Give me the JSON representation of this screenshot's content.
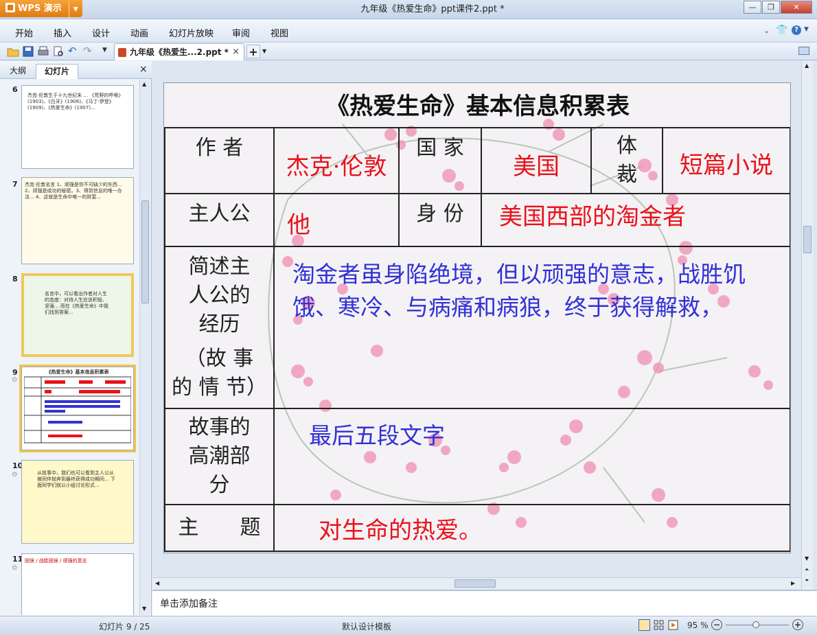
{
  "app": {
    "name": "WPS 演示",
    "window_title": "九年级《热爱生命》ppt课件2.ppt *"
  },
  "menu": [
    "开始",
    "插入",
    "设计",
    "动画",
    "幻灯片放映",
    "审阅",
    "视图"
  ],
  "toolbar": {
    "doc_tab": "九年级《热爱生...2.ppt *",
    "close_glyph": "×",
    "new_tab": "+"
  },
  "left_panel": {
    "tabs": [
      "大纲",
      "幻灯片"
    ],
    "active_tab": "幻灯片",
    "close_glyph": "×",
    "thumbnails": [
      {
        "number": "6",
        "text": "杰克·伦敦生于十九世纪末 ... 《荒野的呼唤》(1903)、《白牙》(1906)、《马丁·伊登》(1909)、《热爱生命》(1907)..."
      },
      {
        "number": "7",
        "text": "杰克·伦敦名言 1、顽强是你不可缺少的东西... 2、顽强是成功的秘密。3、得到信息的唯一办法... 4、这就是生命中唯一的财富..."
      },
      {
        "number": "8",
        "text": "名言中，可以看出作者对人生的态度：对待人生应该积极、坚强... 而在《热爱生命》中我们找到答案..."
      },
      {
        "number": "9",
        "text": "《热爱生命》基本信息积累表"
      },
      {
        "number": "10",
        "text": "从故事中，我们也可以看到主人公从被同伴抛弃到最终获得成功期间... 下面同学们就以小组讨论形式..."
      },
      {
        "number": "11",
        "text": "困境 / 战胜困境 / 顽强的意志"
      }
    ]
  },
  "slide": {
    "title": "《热爱生命》基本信息积累表",
    "rows": {
      "author_label": "作 者",
      "author_value": "杰克·伦敦",
      "country_label": "国 家",
      "country_value": "美国",
      "genre_label_1": "体",
      "genre_label_2": "裁",
      "genre_value": "短篇小说",
      "hero_label": "主人公",
      "hero_value": "他",
      "identity_label": "身 份",
      "identity_value": "美国西部的淘金者",
      "summary_label_1": "简述主",
      "summary_label_2": "人公的",
      "summary_label_3": "经历",
      "summary_label_4": "（故 事",
      "summary_label_5": "的 情 节）",
      "summary_value": "淘金者虽身陷绝境，但以顽强的意志，战胜饥饿、寒冷、与病痛和病狼，终于获得解救，",
      "climax_label_1": "故事的",
      "climax_label_2": "高潮部",
      "climax_label_3": "分",
      "climax_value": "最后五段文字",
      "theme_label": "主　　题",
      "theme_value": "对生命的热爱。"
    }
  },
  "notes": {
    "placeholder": "单击添加备注"
  },
  "status": {
    "slide_counter": "幻灯片 9 / 25",
    "template": "默认设计模板",
    "zoom": "95 %",
    "zoom_fraction": 0.95
  },
  "colors": {
    "red_text": "#e8121b",
    "blue_text": "#3131d4",
    "accent": "#f2c44a",
    "brand": "#e07b10"
  }
}
